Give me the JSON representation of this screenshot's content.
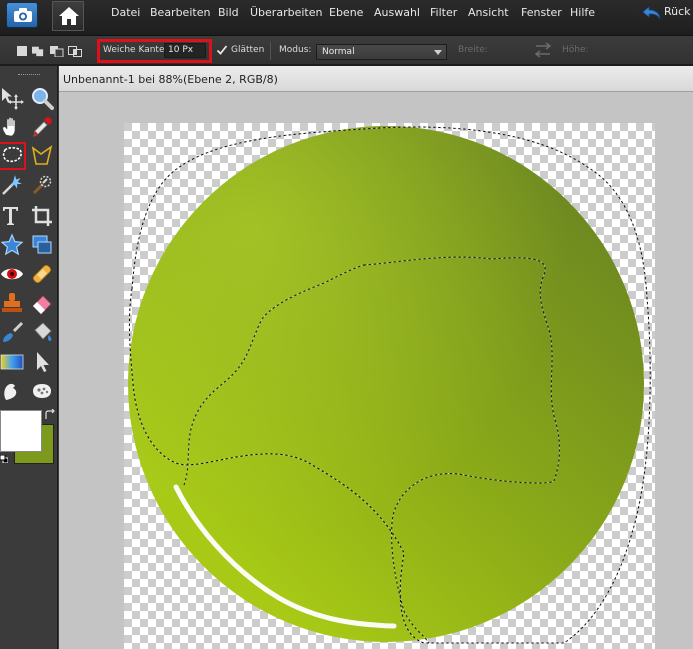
{
  "menu": {
    "items": [
      "Datei",
      "Bearbeiten",
      "Bild",
      "Überarbeiten",
      "Ebene",
      "Auswahl",
      "Filter",
      "Ansicht",
      "Fenster",
      "Hilfe"
    ],
    "undo_label": "Rück"
  },
  "options": {
    "feather_label": "Weiche Kante:",
    "feather_value": "10 Px",
    "smooth_label": "Glätten",
    "smooth_checked": true,
    "mode_label": "Modus:",
    "mode_value": "Normal",
    "width_label": "Breite:",
    "height_label": "Höhe:"
  },
  "document": {
    "title": "Unbenannt-1 bei 88%(Ebene 2, RGB/8)"
  },
  "colors": {
    "foreground": "#ffffff",
    "background": "#7e9a1c",
    "circle_light": "#a8ca16",
    "circle_dark": "#6f8a20",
    "highlight_frame": "#e0101a"
  },
  "tools": {
    "active": "lasso-tool",
    "icons": [
      "move-icon",
      "zoom-icon",
      "hand-icon",
      "eyedropper-icon",
      "lasso-icon",
      "magnetic-lasso-icon",
      "magic-wand-icon",
      "quick-selection-icon",
      "text-icon",
      "crop-icon",
      "custom-shape-icon",
      "recompose-icon",
      "red-eye-icon",
      "healing-brush-icon",
      "clone-stamp-icon",
      "eraser-icon",
      "brush-icon",
      "paint-bucket-icon",
      "gradient-icon",
      "shape-select-icon",
      "smudge-icon",
      "sponge-icon"
    ]
  }
}
